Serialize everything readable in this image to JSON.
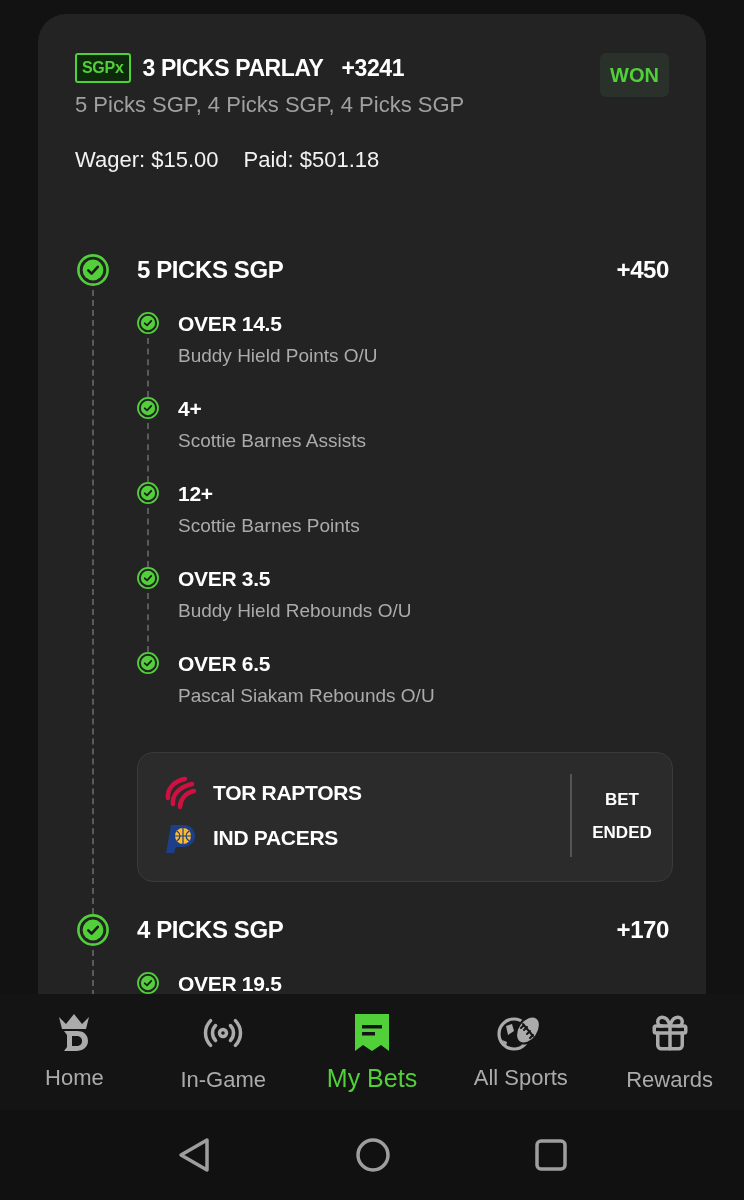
{
  "bet": {
    "badge": "SGPx",
    "title": "3 PICKS PARLAY",
    "odds": "+3241",
    "status": "WON",
    "subtitle": "5 Picks SGP, 4 Picks SGP, 4 Picks SGP",
    "wager": "Wager: $15.00",
    "paid": "Paid: $501.18"
  },
  "legs": [
    {
      "title": "5 PICKS SGP",
      "odds": "+450",
      "won": true,
      "picks": [
        {
          "line": "OVER 14.5",
          "market": "Buddy Hield Points O/U",
          "won": true
        },
        {
          "line": "4+",
          "market": "Scottie Barnes Assists",
          "won": true
        },
        {
          "line": "12+",
          "market": "Scottie Barnes Points",
          "won": true
        },
        {
          "line": "OVER 3.5",
          "market": "Buddy Hield Rebounds O/U",
          "won": true
        },
        {
          "line": "OVER 6.5",
          "market": "Pascal Siakam Rebounds O/U",
          "won": true
        }
      ],
      "game": {
        "teams": [
          "TOR RAPTORS",
          "IND PACERS"
        ],
        "status": "BET ENDED"
      }
    },
    {
      "title": "4 PICKS SGP",
      "odds": "+170",
      "won": true,
      "picks": [
        {
          "line": "OVER 19.5",
          "won": true
        }
      ]
    }
  ],
  "nav": [
    {
      "label": "Home",
      "selected": false
    },
    {
      "label": "In-Game",
      "selected": false
    },
    {
      "label": "My Bets",
      "selected": true
    },
    {
      "label": "All Sports",
      "selected": false
    },
    {
      "label": "Rewards",
      "selected": false
    }
  ]
}
